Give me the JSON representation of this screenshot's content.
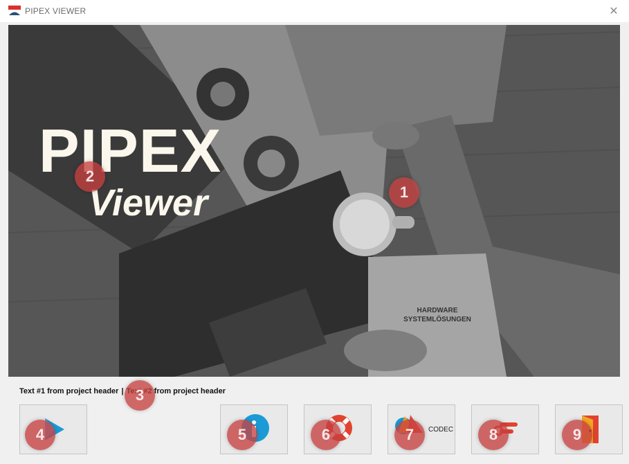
{
  "window": {
    "title": "PIPEX VIEWER",
    "close_glyph": "✕"
  },
  "banner": {
    "brand_line1": "PIPEX",
    "brand_line2": "Viewer",
    "paper_text": "HARDWARE\nSYSTEMLÖSUNGEN"
  },
  "project_header": {
    "text1": "Text #1 from project header",
    "separator": "|",
    "text2": "Text #2 from project header"
  },
  "toolbar": {
    "buttons": [
      {
        "icon": "play-icon"
      },
      {
        "icon": "info-icon"
      },
      {
        "icon": "help-lifebuoy-icon"
      },
      {
        "icon": "codec-icon",
        "label": "CODEC"
      },
      {
        "icon": "settings-pipe-icon"
      },
      {
        "icon": "exit-door-icon"
      }
    ]
  },
  "markers": [
    "1",
    "2",
    "3",
    "4",
    "5",
    "6",
    "7",
    "8",
    "9"
  ],
  "colors": {
    "marker": "#c74040",
    "accent_blue": "#1c9ad6",
    "accent_red": "#e0432f"
  }
}
